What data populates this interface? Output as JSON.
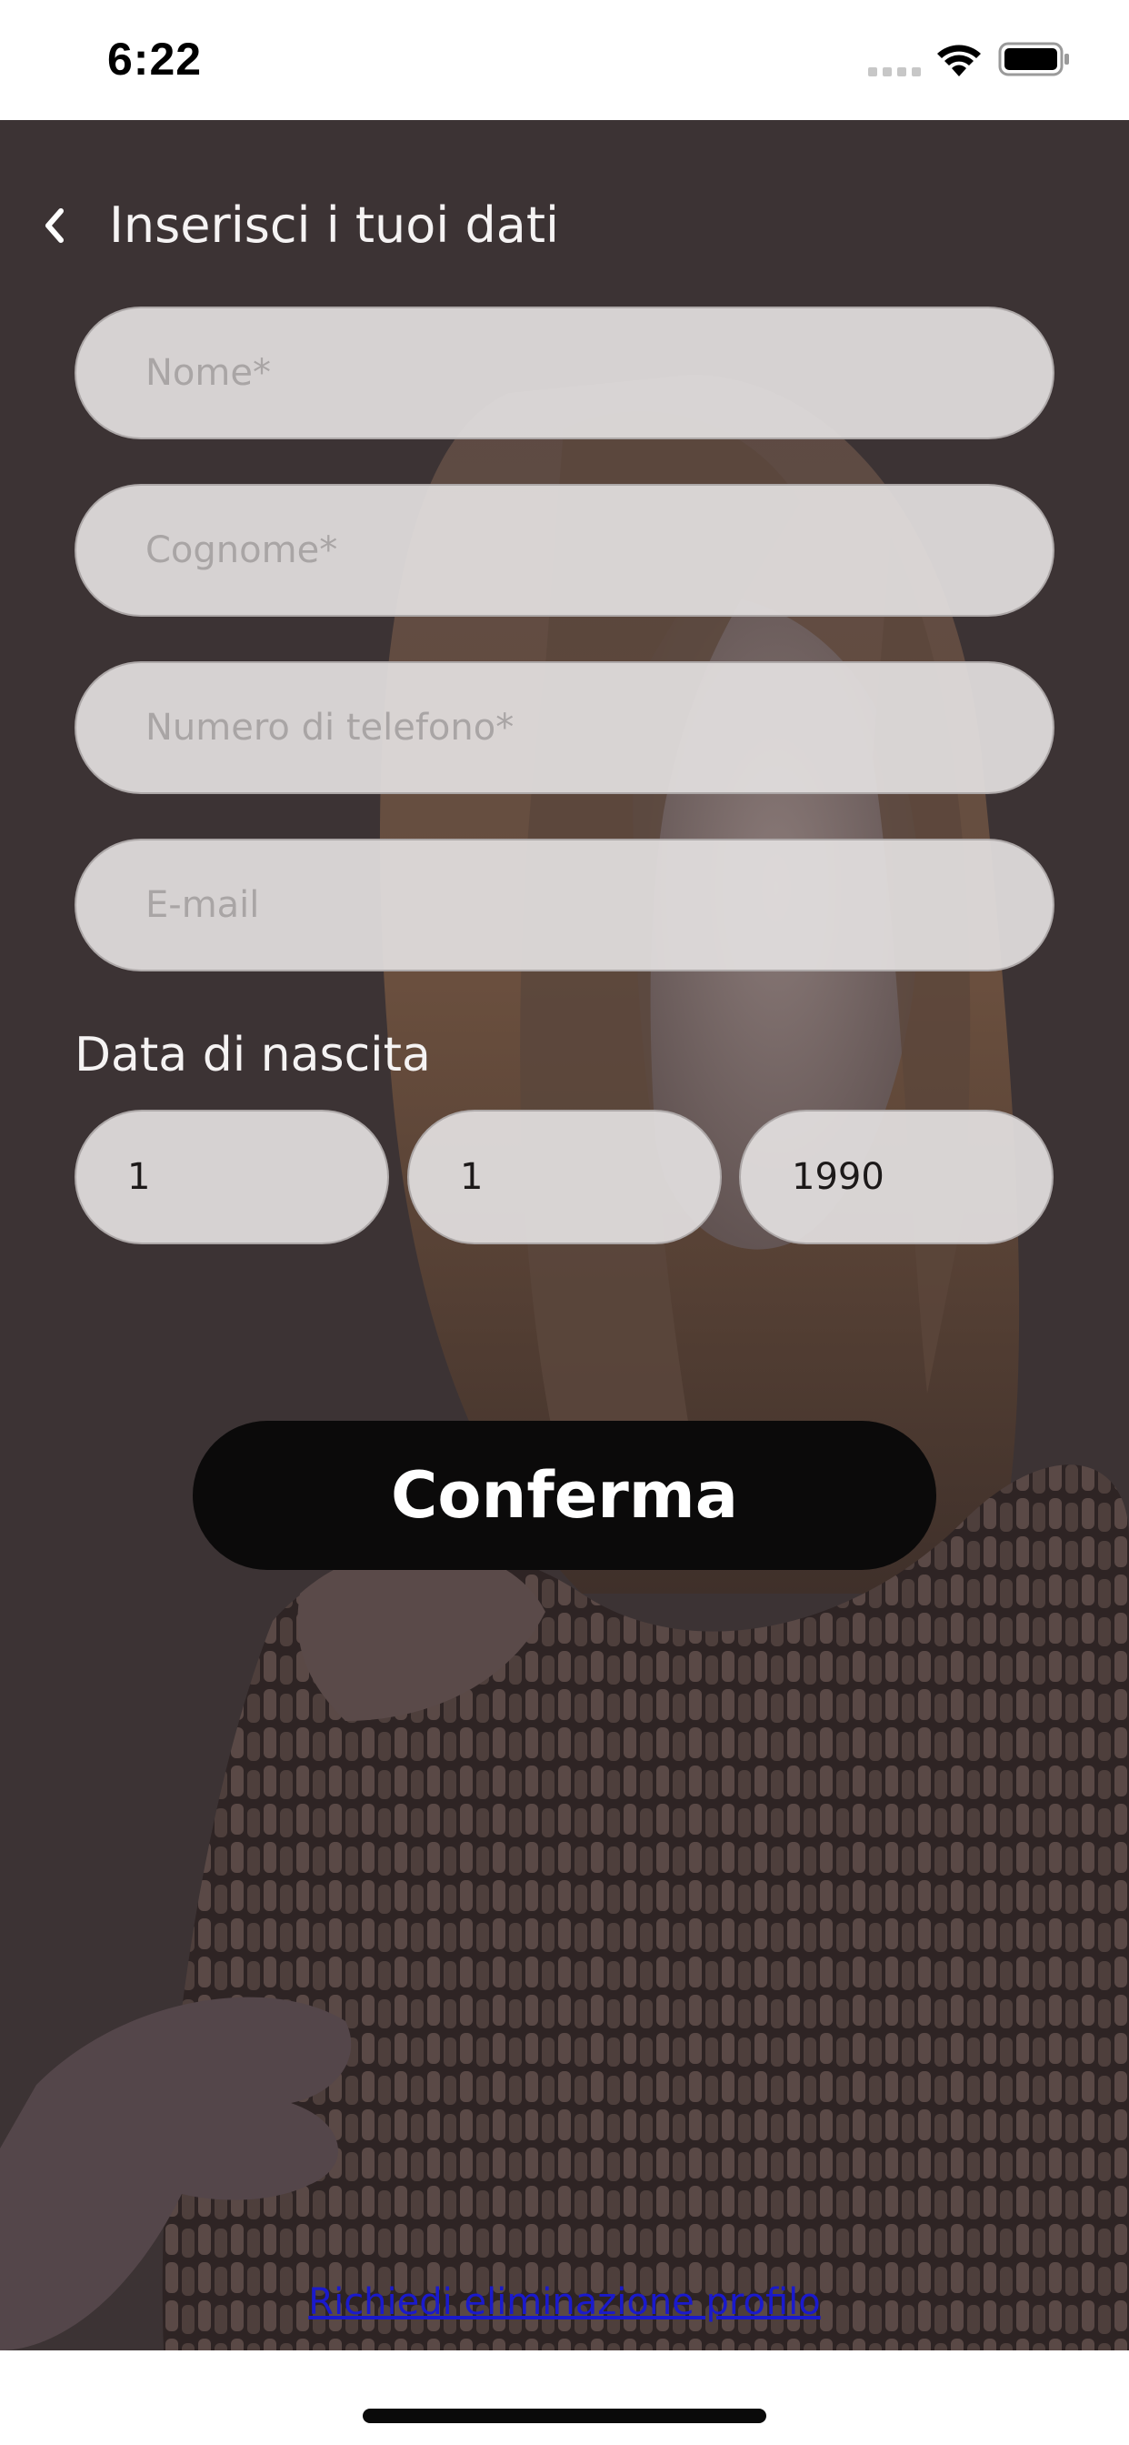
{
  "status_bar": {
    "time": "6:22"
  },
  "header": {
    "title": "Inserisci i tuoi dati",
    "back_icon": "chevron-left-icon"
  },
  "form": {
    "nome_placeholder": "Nome*",
    "nome_value": "",
    "cognome_placeholder": "Cognome*",
    "cognome_value": "",
    "telefono_placeholder": "Numero di telefono*",
    "telefono_value": "",
    "email_placeholder": "E-mail",
    "email_value": "",
    "dob_label": "Data di nascita",
    "dob_day": "1",
    "dob_month": "1",
    "dob_year": "1990"
  },
  "actions": {
    "confirm_label": "Conferma",
    "delete_profile_label": "Richiedi eliminazione profilo"
  },
  "colors": {
    "overlay": "#3c3334",
    "field_background": "#e2dfdf",
    "button_background": "#0b0a0a",
    "link": "#1a1acc"
  }
}
